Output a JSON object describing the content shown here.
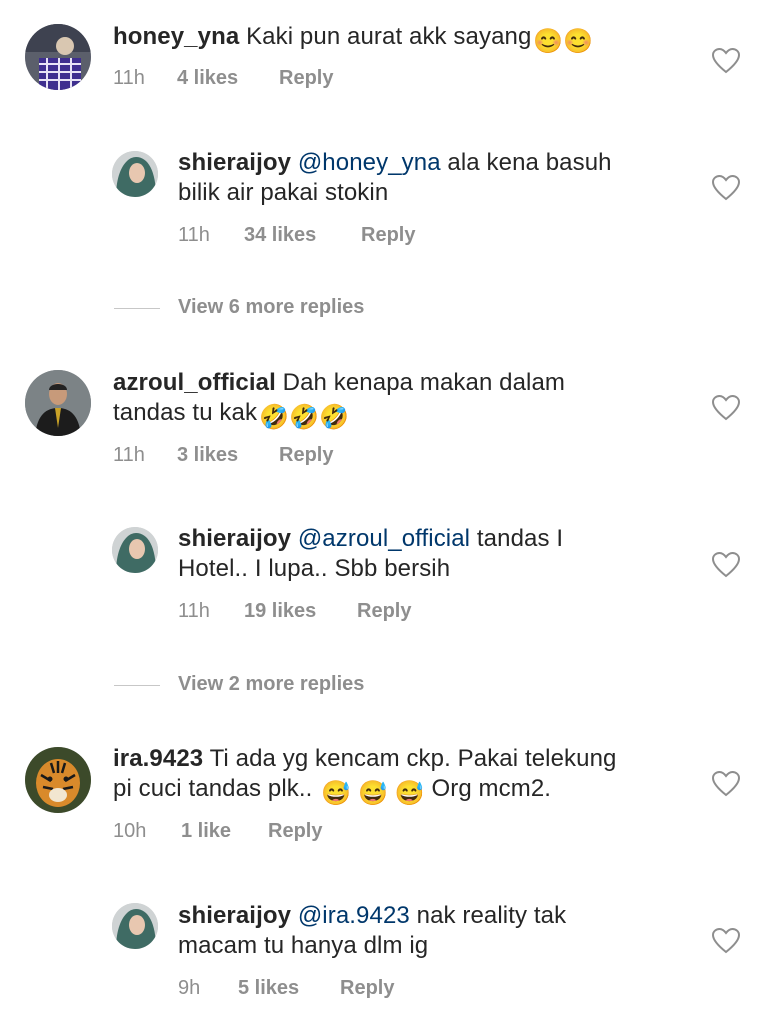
{
  "comments": [
    {
      "username": "honey_yna",
      "text": "Kaki pun aurat akk sayang",
      "emojis": "😊😊",
      "time": "11h",
      "likes": "4 likes",
      "reply": "Reply",
      "avatar": "avatar-honey_yna"
    },
    {
      "username": "shieraijoy",
      "mention": "@honey_yna",
      "text_line1": "ala kena basuh",
      "text_line2": "bilik air pakai stokin",
      "time": "11h",
      "likes": "34 likes",
      "reply": "Reply",
      "avatar": "avatar-shieraijoy"
    },
    {
      "username": "azroul_official",
      "text_line1": "Dah kenapa makan dalam",
      "text_line2": "tandas tu kak",
      "emojis": "🤣🤣🤣",
      "time": "11h",
      "likes": "3 likes",
      "reply": "Reply",
      "avatar": "avatar-azroul_official"
    },
    {
      "username": "shieraijoy",
      "mention": "@azroul_official",
      "text_line1": "tandas I",
      "text_line2": "Hotel.. I lupa.. Sbb bersih",
      "time": "11h",
      "likes": "19 likes",
      "reply": "Reply",
      "avatar": "avatar-shieraijoy"
    },
    {
      "username": "ira.9423",
      "text_line1": "Ti ada yg kencam ckp. Pakai telekung",
      "text_line2a": "pi cuci tandas plk..",
      "emojis": "😅 😅 😅",
      "text_line2b": "Org mcm2.",
      "time": "10h",
      "likes": "1 like",
      "reply": "Reply",
      "avatar": "avatar-ira.9423"
    },
    {
      "username": "shieraijoy",
      "mention": "@ira.9423",
      "text_line1": "nak reality tak",
      "text_line2": "macam tu hanya dlm ig",
      "time": "9h",
      "likes": "5 likes",
      "reply": "Reply",
      "avatar": "avatar-shieraijoy"
    }
  ],
  "view_more": [
    {
      "label": "View 6 more replies"
    },
    {
      "label": "View 2 more replies"
    }
  ],
  "icons": {
    "like": "heart-outline-icon"
  },
  "colors": {
    "text": "#262626",
    "muted": "#8e8e8e",
    "mention": "#00376b"
  }
}
